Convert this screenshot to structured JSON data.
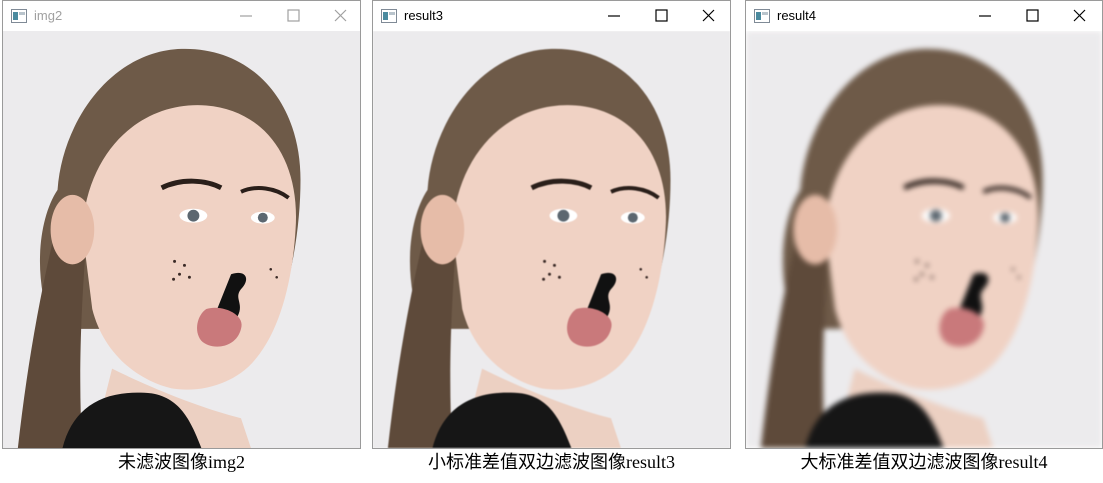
{
  "windows": [
    {
      "title": "img2",
      "title_color": "#a0a0a0",
      "controls_color": "#a0a0a0",
      "blur": 0,
      "photo": "portrait of a woman with cat face paint, head turned, tongue out",
      "caption": "未滤波图像img2"
    },
    {
      "title": "result3",
      "title_color": "#000000",
      "controls_color": "#000000",
      "blur": 0.4,
      "photo": "portrait of a woman with cat face paint, head turned, tongue out",
      "caption": "小标准差值双边滤波图像result3"
    },
    {
      "title": "result4",
      "title_color": "#000000",
      "controls_color": "#000000",
      "blur": 2.6,
      "photo": "portrait of a woman with cat face paint, head turned, tongue out",
      "caption": "大标准差值双边滤波图像result4"
    }
  ],
  "icons": {
    "app": "window-app-icon",
    "minimize": "minimize-icon",
    "maximize": "maximize-icon",
    "close": "close-icon"
  },
  "colors": {
    "background": "#ecebed",
    "hair": "#6e5a48",
    "skin": "#f0d2c4",
    "top": "#161616"
  }
}
